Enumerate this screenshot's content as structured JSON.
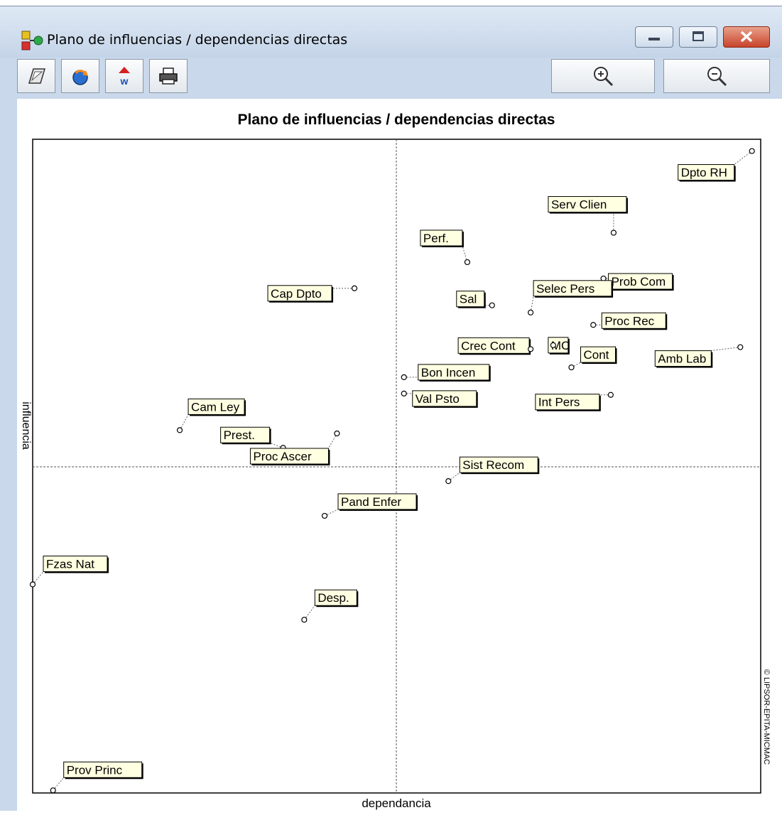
{
  "window": {
    "title": "Plano de influencias / dependencias directas"
  },
  "toolbar": {
    "buttons": [
      {
        "name": "copy-button",
        "icon": "copy-icon"
      },
      {
        "name": "refresh-button",
        "icon": "refresh-icon"
      },
      {
        "name": "word-export-button",
        "icon": "word-export-icon"
      },
      {
        "name": "print-button",
        "icon": "printer-icon"
      }
    ],
    "zoom": [
      {
        "name": "zoom-in-button",
        "icon": "zoom-in-icon"
      },
      {
        "name": "zoom-out-button",
        "icon": "zoom-out-icon"
      }
    ]
  },
  "colors": {
    "label_fill": "#ffffe1",
    "point_fill": "#ffffff",
    "axis": "#000000",
    "window_bg": "#c9d8ea",
    "close_button": "#c8442b"
  },
  "chart_data": {
    "type": "scatter",
    "title": "Plano de influencias / dependencias directas",
    "xlabel": "dependancia",
    "ylabel": "influencia",
    "credit": "© LIPSOR-EPITA-MICMAC",
    "grid": false,
    "quadrant_lines": true,
    "points": [
      {
        "label": "Dpto RH",
        "x": 98.8,
        "y": 98.2
      },
      {
        "label": "Perf.",
        "x": 59.7,
        "y": 81.2
      },
      {
        "label": "Serv Clien",
        "x": 79.8,
        "y": 85.7
      },
      {
        "label": "Prob Com",
        "x": 78.4,
        "y": 78.7
      },
      {
        "label": "Cap Dpto",
        "x": 44.2,
        "y": 77.2
      },
      {
        "label": "Selec Pers",
        "x": 68.4,
        "y": 73.5
      },
      {
        "label": "Sal",
        "x": 63.1,
        "y": 74.6
      },
      {
        "label": "Proc Rec",
        "x": 77.0,
        "y": 71.6
      },
      {
        "label": "Crec Cont",
        "x": 68.4,
        "y": 67.9
      },
      {
        "label": "MC",
        "x": 71.5,
        "y": 68.5
      },
      {
        "label": "Cont",
        "x": 74.0,
        "y": 65.1
      },
      {
        "label": "Amb Lab",
        "x": 97.2,
        "y": 68.2
      },
      {
        "label": "Bon Incen",
        "x": 51.0,
        "y": 63.6
      },
      {
        "label": "Val Psto",
        "x": 51.0,
        "y": 61.1
      },
      {
        "label": "Int Pers",
        "x": 79.4,
        "y": 60.9
      },
      {
        "label": "Cam Ley",
        "x": 20.2,
        "y": 55.5
      },
      {
        "label": "Prest.",
        "x": 34.4,
        "y": 52.8
      },
      {
        "label": "Proc Ascer",
        "x": 41.8,
        "y": 55.0
      },
      {
        "label": "Sist Recom",
        "x": 57.1,
        "y": 47.7
      },
      {
        "label": "Pand Enfer",
        "x": 40.1,
        "y": 42.4
      },
      {
        "label": "Fzas Nat",
        "x": 0.0,
        "y": 31.9
      },
      {
        "label": "Desp.",
        "x": 37.3,
        "y": 26.5
      },
      {
        "label": "Prov Princ",
        "x": 2.8,
        "y": 0.4
      }
    ]
  }
}
